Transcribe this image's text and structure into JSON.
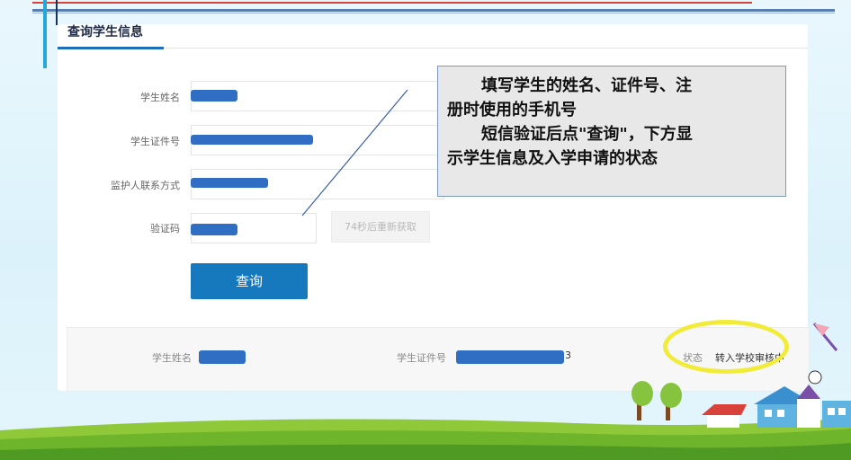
{
  "card": {
    "title": "查询学生信息"
  },
  "form": {
    "student_name_label": "学生姓名",
    "student_id_label": "学生证件号",
    "guardian_phone_label": "监护人联系方式",
    "code_label": "验证码",
    "resend_button": "74秒后重新获取",
    "query_button": "查询"
  },
  "result": {
    "name_label": "学生姓名",
    "id_label": "学生证件号",
    "id_suffix": "3",
    "status_label": "状态",
    "status_value": "转入学校审核中"
  },
  "callout": {
    "line1": "填写学生的姓名、证件号、注",
    "line2": "册时使用的手机号",
    "line3": "短信验证后点\"查询\"，下方显",
    "line4": "示学生信息及入学申请的状态"
  },
  "colors": {
    "primary_button": "#1779bd",
    "mask_blue": "#2f6ec2",
    "highlight": "#f1ec3a",
    "title_accent": "#1a6fb8"
  }
}
